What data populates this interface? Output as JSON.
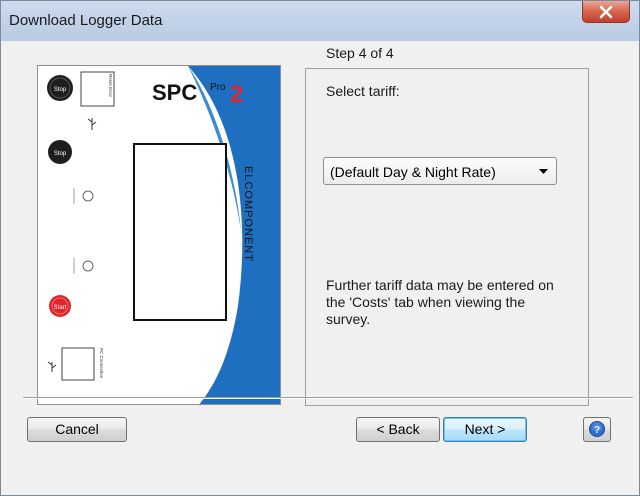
{
  "window": {
    "title": "Download Logger Data"
  },
  "device": {
    "brand": "SPC",
    "model_superscript": "Pro",
    "model_number": "2",
    "side_text": "ELCOMPONENT",
    "btn_top_label": "Stop",
    "btn_mid_label": "Stop",
    "btn_red_label": "Start"
  },
  "wizard": {
    "step": "Step 4 of 4",
    "prompt": "Select tariff:",
    "tariff_value": "(Default Day & Night Rate)",
    "info": "Further tariff data may be entered on the 'Costs' tab when viewing the survey."
  },
  "buttons": {
    "cancel": "Cancel",
    "back": "< Back",
    "next": "Next >"
  },
  "colors": {
    "accent_blue": "#1f6fc1",
    "brand_red": "#e0242b"
  }
}
